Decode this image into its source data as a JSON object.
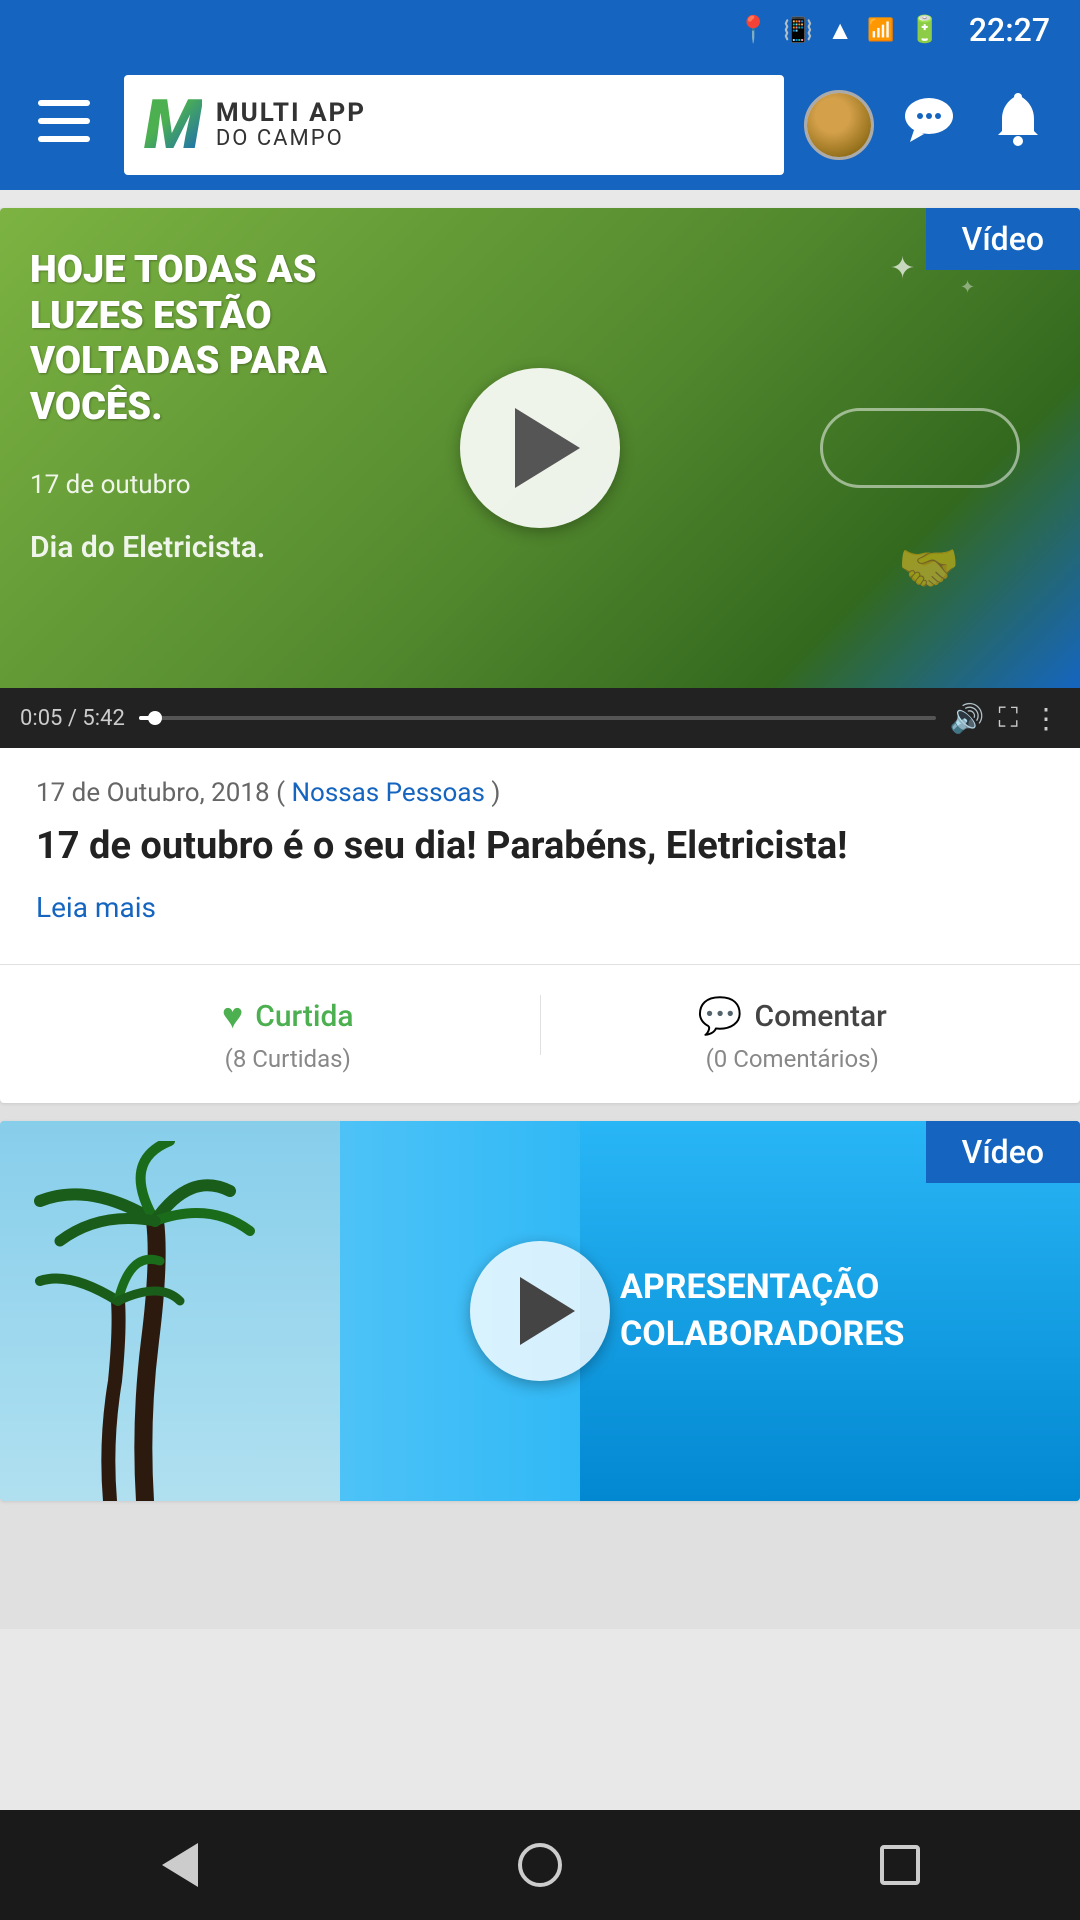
{
  "statusBar": {
    "time": "22:27",
    "icons": [
      "location",
      "vibrate",
      "wifi",
      "signal",
      "battery"
    ]
  },
  "appBar": {
    "menuLabel": "☰",
    "logoLetter": "M",
    "logoTop": "MULTI APP",
    "logoBottom": "DO CAMPO",
    "chatIconLabel": "💬",
    "bellIconLabel": "🔔"
  },
  "post1": {
    "videoBadge": "Vídeo",
    "videoMainText": "HOJE TODAS AS LUZES ESTÃO VOLTADAS PARA VOCÊS.",
    "videoSubText1": "17 de outubro",
    "videoSubText2": "Dia do Eletricista.",
    "timeCode": "0:05 / 5:42",
    "date": "17 de Outubro, 2018",
    "category": "Nossas Pessoas",
    "title": "17 de outubro é o seu dia! Parabéns, Eletricista!",
    "readMore": "Leia mais",
    "likeLabel": "Curtida",
    "likeCount": "(8 Curtidas)",
    "commentLabel": "Comentar",
    "commentCount": "(0 Comentários)"
  },
  "post2": {
    "videoBadge": "Vídeo",
    "overlayText1": "APRESENTAÇÃO",
    "overlayText2": "COLABORADORES"
  },
  "navBar": {
    "backLabel": "back",
    "homeLabel": "home",
    "recentsLabel": "recents"
  }
}
